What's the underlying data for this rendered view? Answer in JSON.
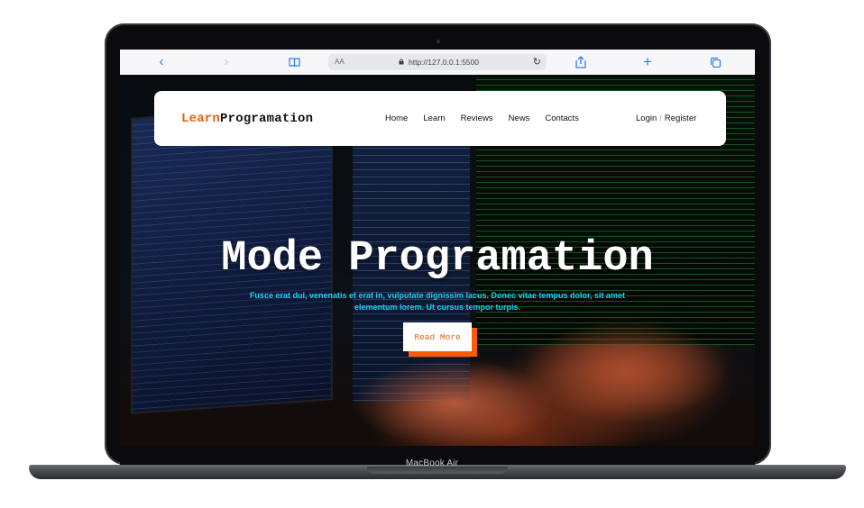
{
  "device": {
    "label": "MacBook Air"
  },
  "browser": {
    "text_size_label": "AA",
    "url": "http://127.0.0.1:5500",
    "icons": [
      "chevron-left-icon",
      "chevron-right-icon",
      "book-icon",
      "lock-icon",
      "reload-icon",
      "share-icon",
      "plus-icon",
      "tabs-icon"
    ]
  },
  "navbar": {
    "logo": {
      "part1": "Learn",
      "part2": "Programation"
    },
    "links": [
      "Home",
      "Learn",
      "Reviews",
      "News",
      "Contacts"
    ],
    "auth": {
      "login": "Login",
      "separator": "/",
      "register": "Register"
    }
  },
  "hero": {
    "title": "Mode Programation",
    "subtitle": "Fusce erat dui, venenatis et erat in, vulputate dignissim lacus. Donec vitae tempus dolor, sit amet elementum lorem. Ut cursus tempor turpis.",
    "cta": "Read More"
  },
  "colors": {
    "accent": "#e8620f",
    "cta_shadow": "#ff5a00",
    "subtitle": "#18d3f0",
    "browser_blue": "#2f7cf6"
  }
}
